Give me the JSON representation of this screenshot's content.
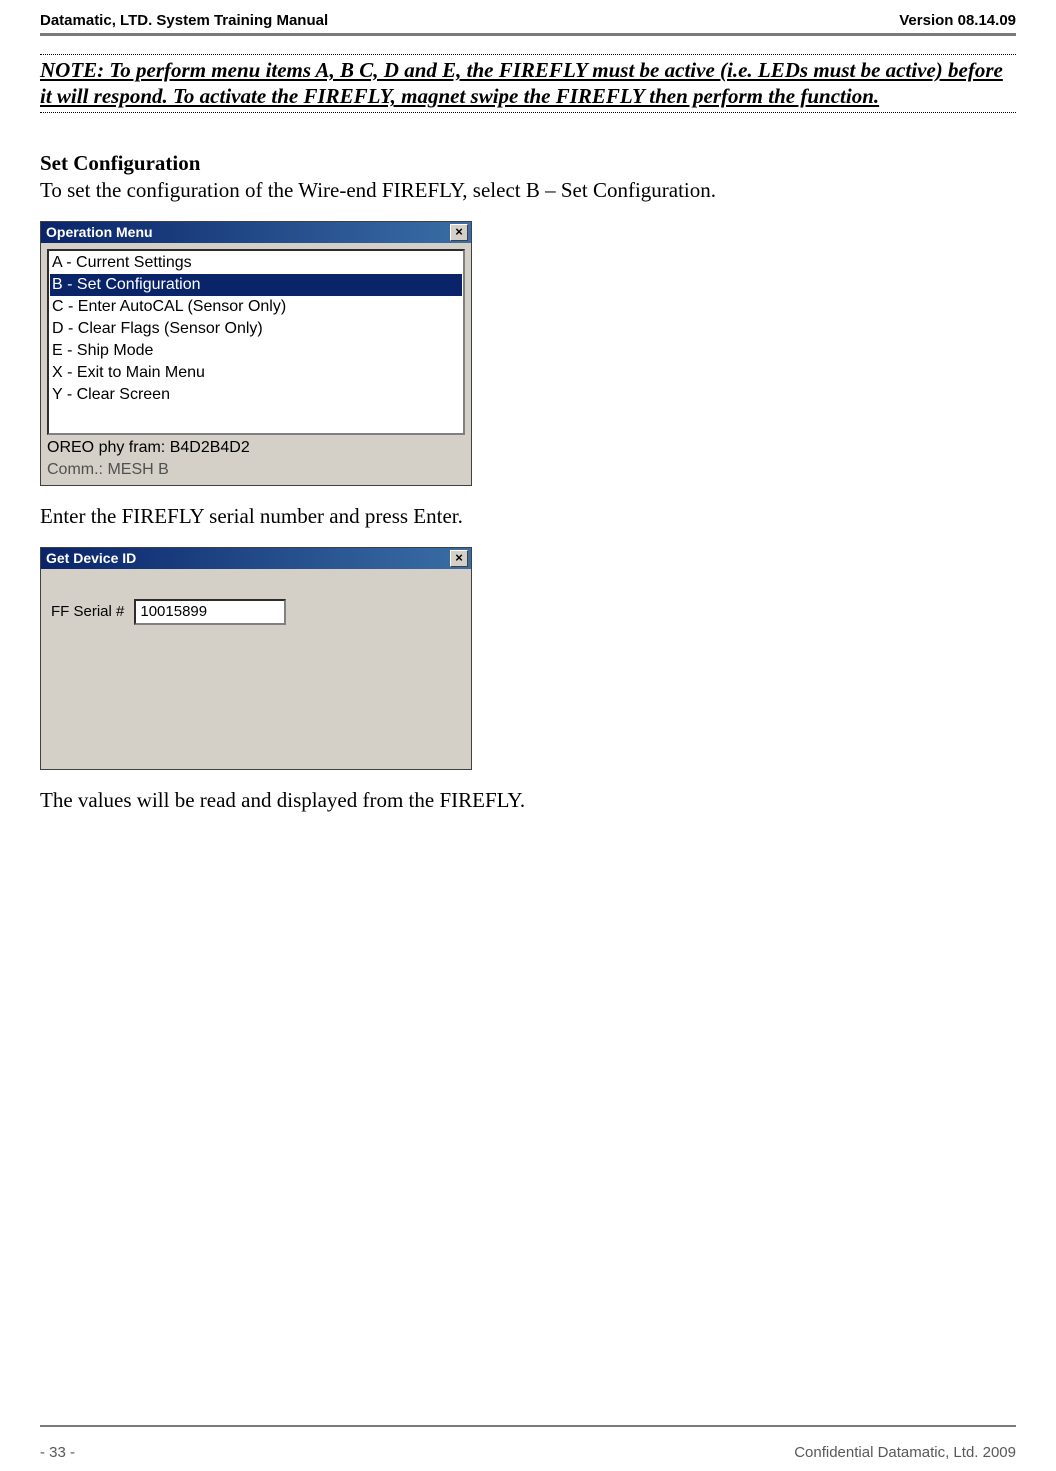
{
  "header": {
    "left": "Datamatic, LTD. System Training  Manual",
    "right": "Version 08.14.09"
  },
  "note": "NOTE: To perform menu items A, B C, D and E, the FIREFLY must be active (i.e. LEDs must be active) before it will respond.  To activate the FIREFLY, magnet swipe the FIREFLY then perform the function.",
  "sectionTitle": "Set Configuration",
  "body1": "To set the configuration of the Wire-end FIREFLY, select B – Set Configuration.",
  "operationMenu": {
    "title": "Operation Menu",
    "close": "×",
    "items": [
      "A - Current Settings",
      "B - Set Configuration",
      "C - Enter AutoCAL (Sensor Only)",
      "D - Clear Flags (Sensor Only)",
      "E - Ship Mode",
      "X - Exit to Main Menu",
      "Y - Clear Screen"
    ],
    "selectedIndex": 1,
    "status1": "OREO phy fram: B4D2B4D2",
    "status2": "Comm.: MESH   B"
  },
  "body2": "Enter the FIREFLY serial number and press Enter.",
  "getDeviceId": {
    "title": "Get Device ID",
    "close": "×",
    "label": "FF Serial #",
    "value": "10015899"
  },
  "body3": "The values will be read and displayed from the FIREFLY.",
  "footer": {
    "left": "- 33 -",
    "right": "Confidential Datamatic, Ltd. 2009"
  }
}
